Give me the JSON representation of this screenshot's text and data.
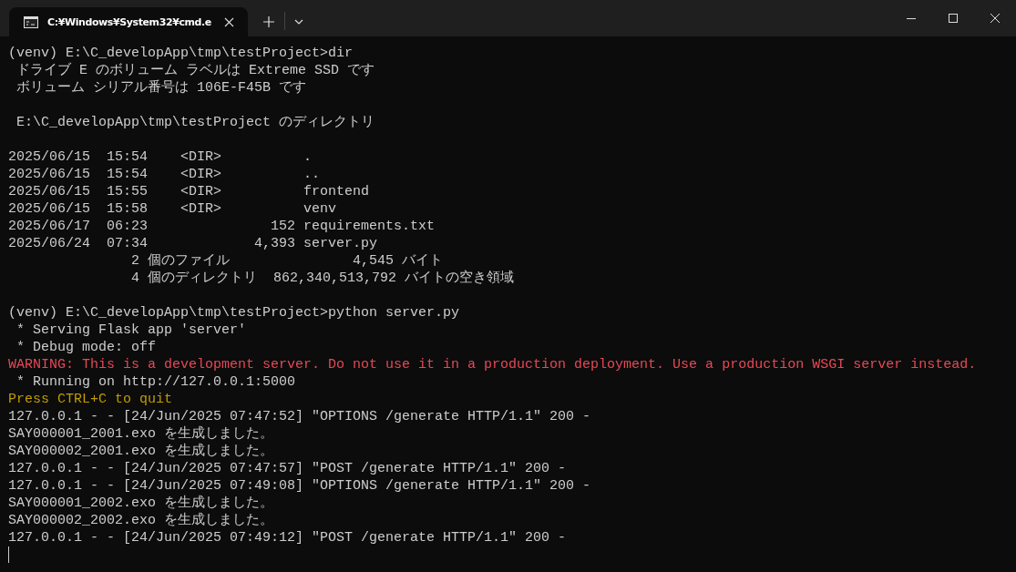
{
  "window": {
    "tab": {
      "title": "C:¥Windows¥System32¥cmd.e",
      "selected": true
    }
  },
  "terminal": {
    "lines": [
      {
        "kind": "normal",
        "text": "(venv) E:\\C_developApp\\tmp\\testProject>dir"
      },
      {
        "kind": "normal",
        "text": " ドライブ E のボリューム ラベルは Extreme SSD です"
      },
      {
        "kind": "normal",
        "text": " ボリューム シリアル番号は 106E-F45B です"
      },
      {
        "kind": "blank"
      },
      {
        "kind": "normal",
        "text": " E:\\C_developApp\\tmp\\testProject のディレクトリ"
      },
      {
        "kind": "blank"
      },
      {
        "kind": "normal",
        "text": "2025/06/15  15:54    <DIR>          ."
      },
      {
        "kind": "normal",
        "text": "2025/06/15  15:54    <DIR>          .."
      },
      {
        "kind": "normal",
        "text": "2025/06/15  15:55    <DIR>          frontend"
      },
      {
        "kind": "normal",
        "text": "2025/06/15  15:58    <DIR>          venv"
      },
      {
        "kind": "normal",
        "text": "2025/06/17  06:23               152 requirements.txt"
      },
      {
        "kind": "normal",
        "text": "2025/06/24  07:34             4,393 server.py"
      },
      {
        "kind": "normal",
        "text": "               2 個のファイル               4,545 バイト"
      },
      {
        "kind": "normal",
        "text": "               4 個のディレクトリ  862,340,513,792 バイトの空き領域"
      },
      {
        "kind": "blank"
      },
      {
        "kind": "normal",
        "text": "(venv) E:\\C_developApp\\tmp\\testProject>python server.py"
      },
      {
        "kind": "normal",
        "text": " * Serving Flask app 'server'"
      },
      {
        "kind": "normal",
        "text": " * Debug mode: off"
      },
      {
        "kind": "warning",
        "text": "WARNING: This is a development server. Do not use it in a production deployment. Use a production WSGI server instead."
      },
      {
        "kind": "normal",
        "text": " * Running on http://127.0.0.1:5000"
      },
      {
        "kind": "notice",
        "text": "Press CTRL+C to quit"
      },
      {
        "kind": "normal",
        "text": "127.0.0.1 - - [24/Jun/2025 07:47:52] \"OPTIONS /generate HTTP/1.1\" 200 -"
      },
      {
        "kind": "normal",
        "text": "SAY000001_2001.exo を生成しました。"
      },
      {
        "kind": "normal",
        "text": "SAY000002_2001.exo を生成しました。"
      },
      {
        "kind": "normal",
        "text": "127.0.0.1 - - [24/Jun/2025 07:47:57] \"POST /generate HTTP/1.1\" 200 -"
      },
      {
        "kind": "normal",
        "text": "127.0.0.1 - - [24/Jun/2025 07:49:08] \"OPTIONS /generate HTTP/1.1\" 200 -"
      },
      {
        "kind": "normal",
        "text": "SAY000001_2002.exo を生成しました。"
      },
      {
        "kind": "normal",
        "text": "SAY000002_2002.exo を生成しました。"
      },
      {
        "kind": "normal",
        "text": "127.0.0.1 - - [24/Jun/2025 07:49:12] \"POST /generate HTTP/1.1\" 200 -"
      }
    ]
  }
}
